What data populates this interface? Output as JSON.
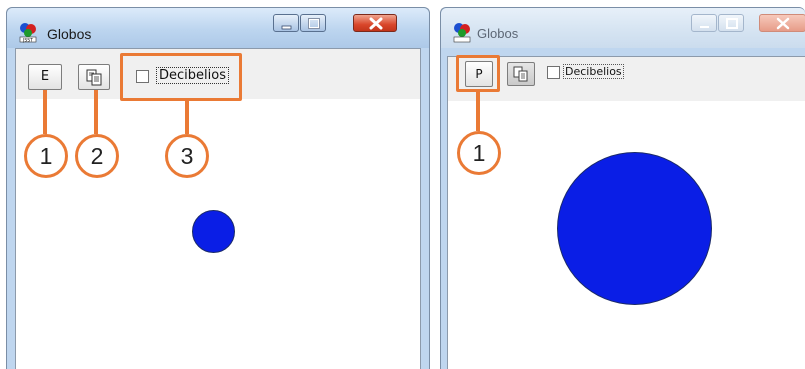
{
  "windows": [
    {
      "title": "Globos",
      "toolbar": {
        "mode_button_label": "E",
        "checkbox_label": "Decibelios",
        "checkbox_checked": false
      },
      "callouts": [
        "1",
        "2",
        "3"
      ]
    },
    {
      "title": "Globos",
      "toolbar": {
        "mode_button_label": "P",
        "checkbox_label": "Decibelios",
        "checkbox_checked": false
      },
      "callouts": [
        "1"
      ]
    }
  ],
  "icons": [
    "app-icon",
    "copy-icon",
    "minimize-icon",
    "maximize-icon",
    "close-icon"
  ],
  "colors": {
    "callout": "#ea7a35",
    "balloon": "#0a1ee6",
    "window_frame": "#bfd6ef",
    "close_button": "#d9462a"
  }
}
